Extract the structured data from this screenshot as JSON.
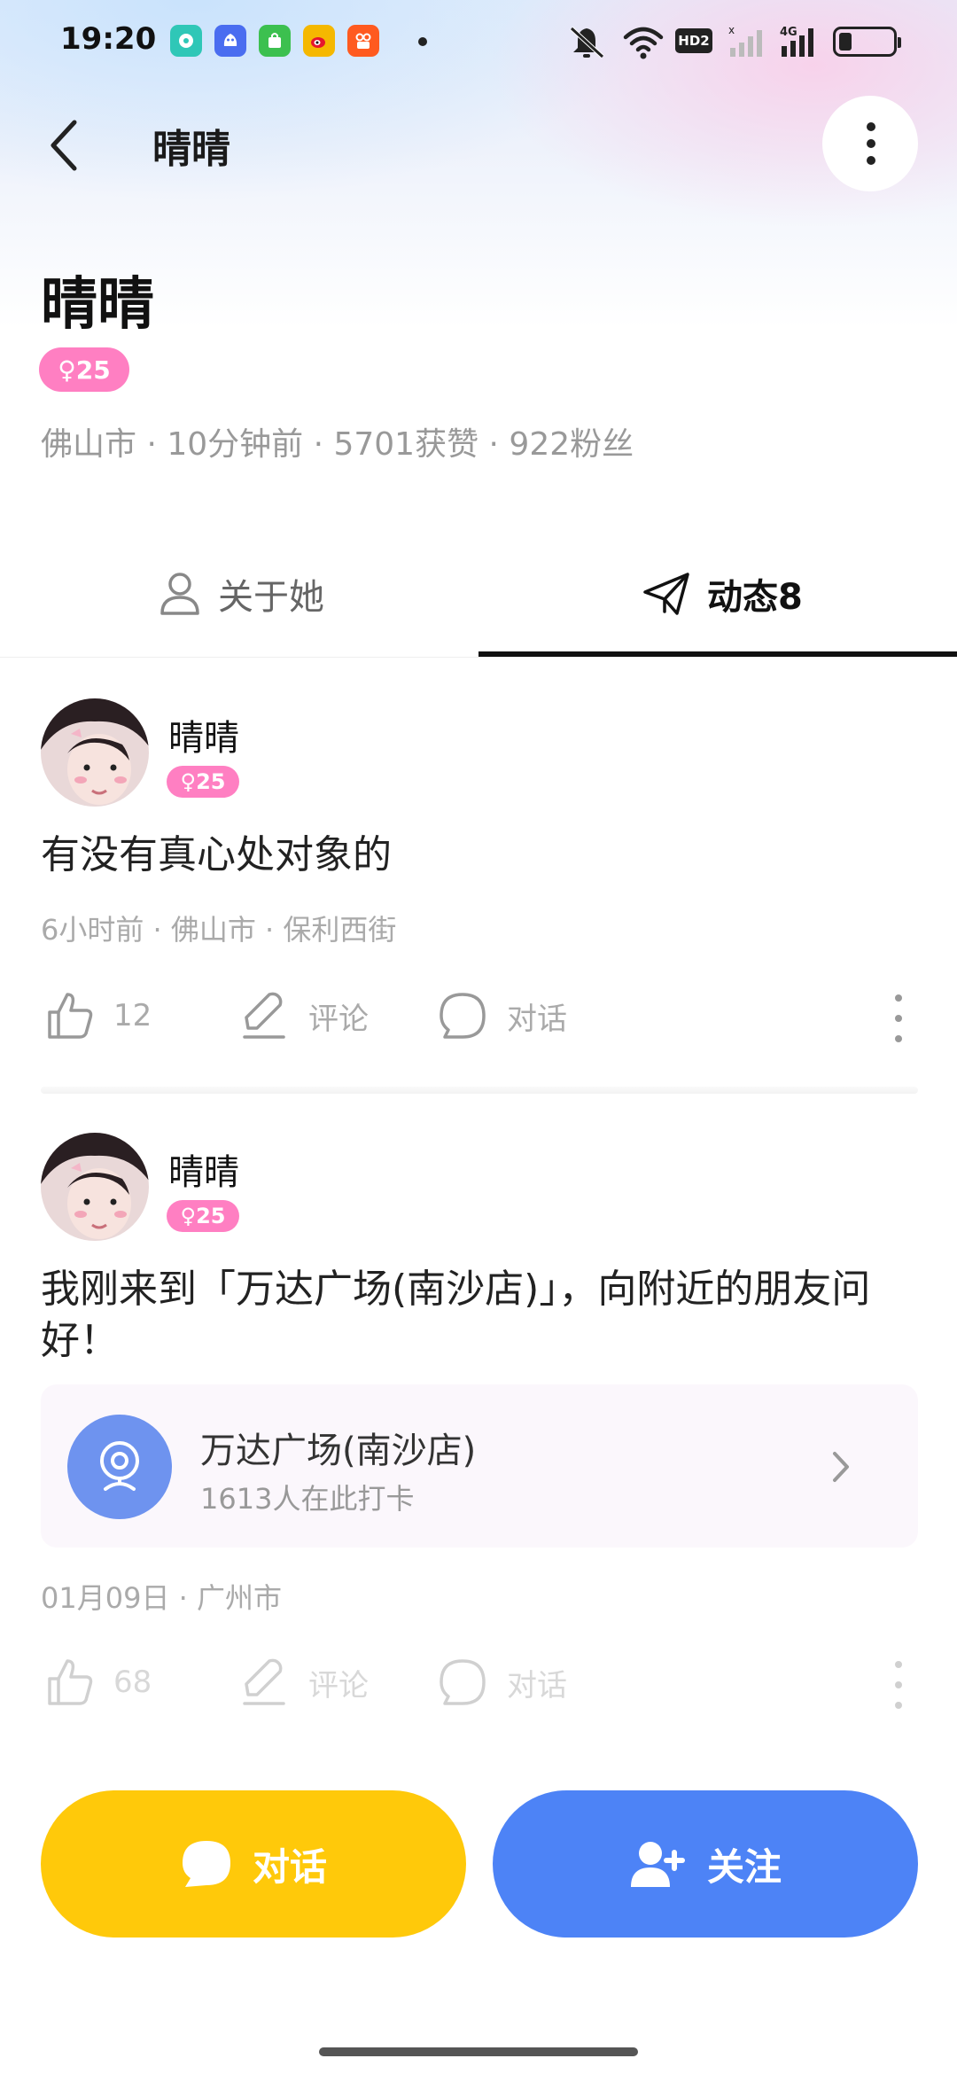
{
  "status_bar": {
    "time": "19:20",
    "network_badge": "HD2",
    "network_type": "4G",
    "app_icons": [
      "chat-app-icon",
      "qq-icon",
      "shopping-app-icon",
      "weibo-icon",
      "kuaishou-icon"
    ],
    "app_icon_colors": [
      "#2fc7b7",
      "#4a6df0",
      "#3cc04f",
      "#f5b800",
      "#ff5a1f"
    ]
  },
  "nav": {
    "back_icon": "chevron-left-icon",
    "title": "晴晴",
    "more_icon": "more-vertical-icon"
  },
  "profile": {
    "name": "晴晴",
    "gender_badge": "♀25",
    "meta": "佛山市 · 10分钟前 · 5701获赞 · 922粉丝"
  },
  "tabs": {
    "about_label": "关于她",
    "posts_label": "动态8",
    "active": "posts"
  },
  "posts": [
    {
      "author": "晴晴",
      "badge": "♀25",
      "text": "有没有真心处对象的",
      "meta": "6小时前 · 佛山市 · 保利西街",
      "likes": "12",
      "comment_label": "评论",
      "chat_label": "对话"
    },
    {
      "author": "晴晴",
      "badge": "♀25",
      "text": "我刚来到「万达广场(南沙店)」，向附近的朋友问好！",
      "location": {
        "name": "万达广场(南沙店)",
        "checkins": "1613人在此打卡"
      },
      "meta": "01月09日 · 广州市",
      "likes": "68",
      "comment_label": "评论",
      "chat_label": "对话"
    }
  ],
  "bottom": {
    "chat_label": "对话",
    "follow_label": "关注",
    "chat_color": "#ffc90a",
    "follow_color": "#4d83f6"
  },
  "colors": {
    "accent_pink": "#ff7fc2",
    "location_blue": "#6e93ef"
  }
}
